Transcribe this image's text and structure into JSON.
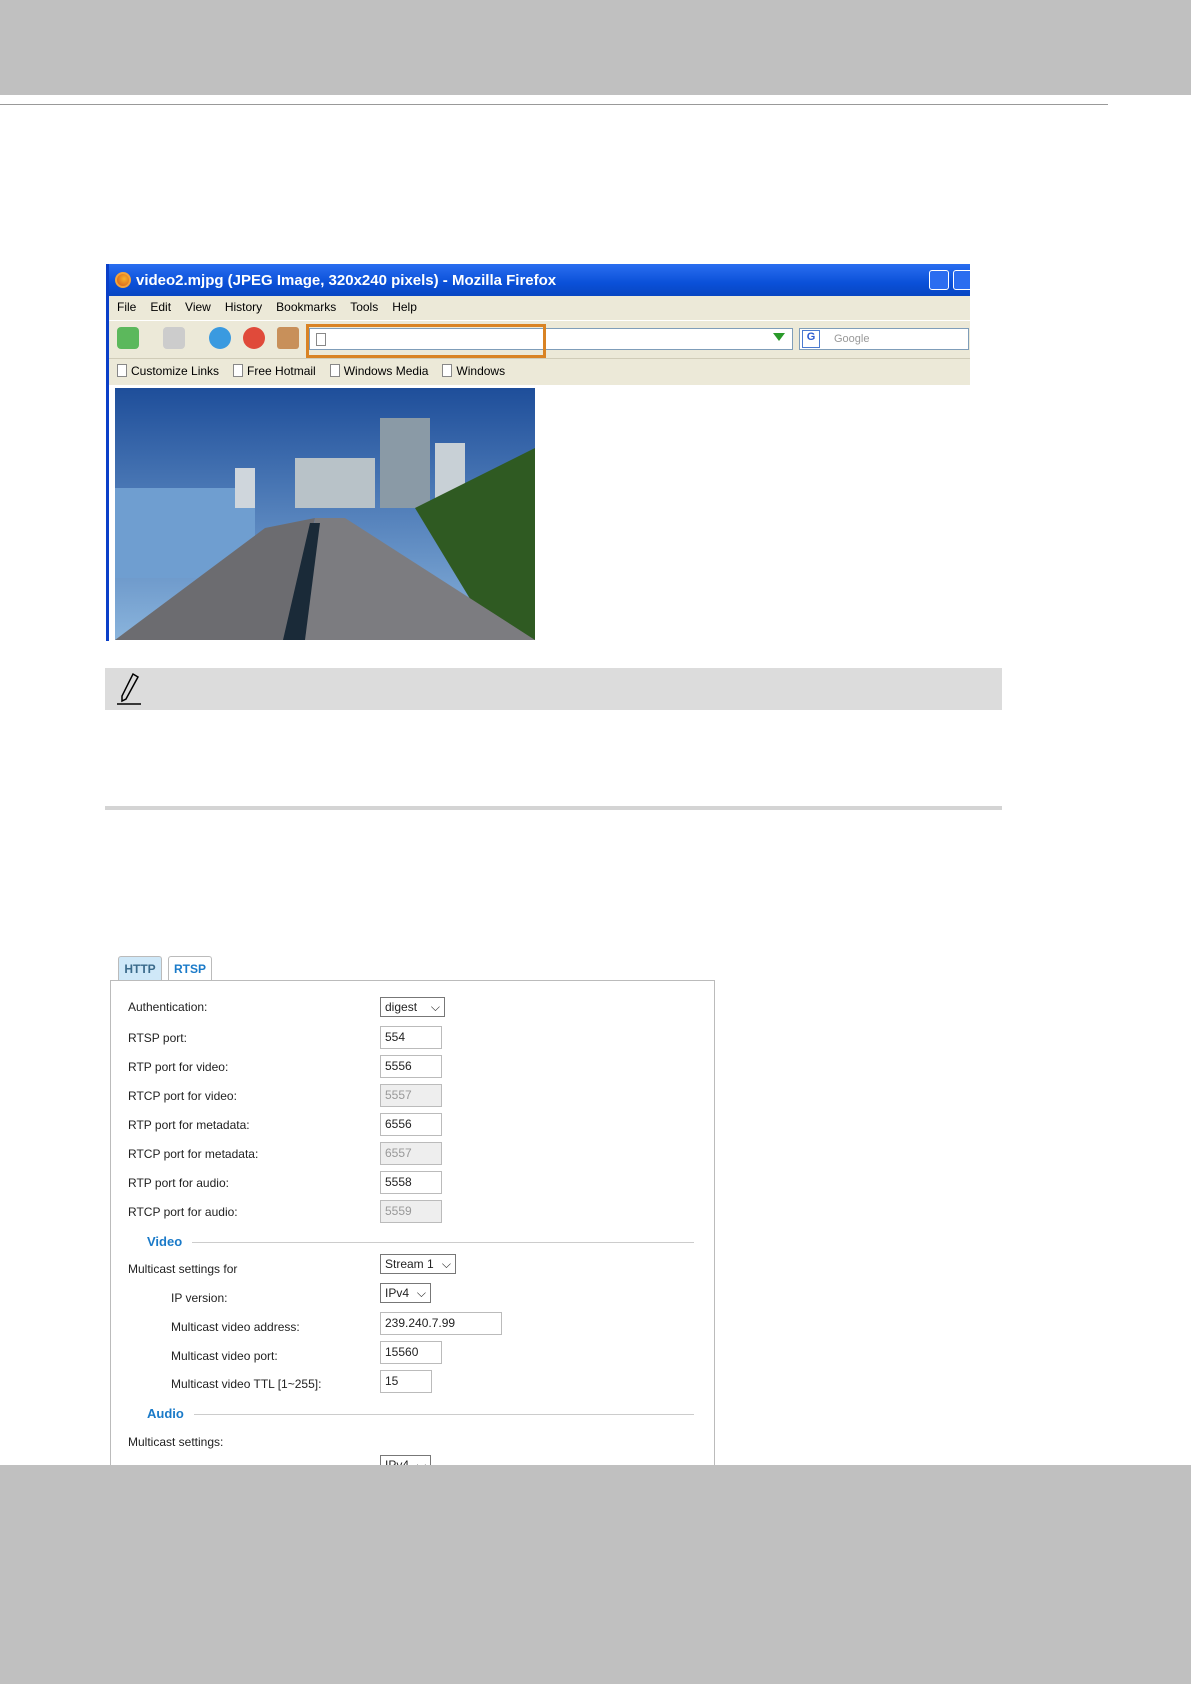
{
  "browser": {
    "title": "video2.mjpg (JPEG Image, 320x240 pixels) - Mozilla Firefox",
    "menu": [
      "File",
      "Edit",
      "View",
      "History",
      "Bookmarks",
      "Tools",
      "Help"
    ],
    "url": "",
    "search_placeholder": "Google",
    "bookmarks": [
      "Customize Links",
      "Free Hotmail",
      "Windows Media",
      "Windows"
    ],
    "highlight_color": "#d98324"
  },
  "tabs": [
    "HTTP",
    "RTSP"
  ],
  "form": {
    "rows": [
      {
        "label": "Authentication:",
        "value": "digest",
        "type": "select"
      },
      {
        "label": "RTSP port:",
        "value": "554",
        "type": "input"
      },
      {
        "label": "RTP port for video:",
        "value": "5556",
        "type": "input"
      },
      {
        "label": "RTCP port for video:",
        "value": "5557",
        "type": "disabled"
      },
      {
        "label": "RTP port for metadata:",
        "value": "6556",
        "type": "input"
      },
      {
        "label": "RTCP port for metadata:",
        "value": "6557",
        "type": "disabled"
      },
      {
        "label": "RTP port for audio:",
        "value": "5558",
        "type": "input"
      },
      {
        "label": "RTCP port for audio:",
        "value": "5559",
        "type": "disabled"
      }
    ],
    "video": {
      "legend": "Video",
      "multicast_label": "Multicast settings for",
      "stream": "Stream 1",
      "ip_version_label": "IP version:",
      "ip_version": "IPv4",
      "address_label": "Multicast video address:",
      "address": "239.240.7.99",
      "port_label": "Multicast video port:",
      "port": "15560",
      "ttl_label": "Multicast video TTL [1~255]:",
      "ttl": "15"
    },
    "audio": {
      "legend": "Audio",
      "multicast_label": "Multicast settings:",
      "ip_version": "IPv4"
    }
  }
}
